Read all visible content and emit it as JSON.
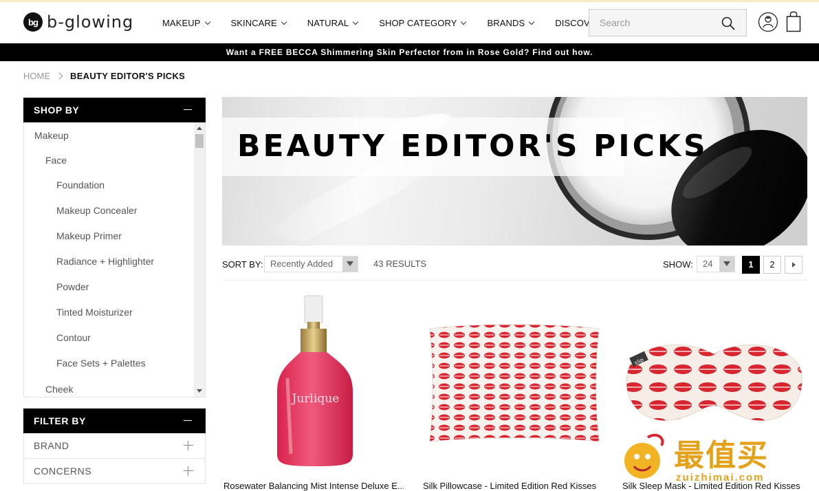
{
  "brand": {
    "logo_mark": "bg",
    "logo_text": "b-glowing"
  },
  "nav": [
    {
      "label": "MAKEUP"
    },
    {
      "label": "SKINCARE"
    },
    {
      "label": "NATURAL"
    },
    {
      "label": "SHOP CATEGORY"
    },
    {
      "label": "BRANDS"
    },
    {
      "label": "DISCOVERY"
    }
  ],
  "search": {
    "placeholder": "Search",
    "icon": "search-icon"
  },
  "header_icons": [
    "account-icon",
    "shopping-bag-icon"
  ],
  "promo": {
    "text": "Want a FREE BECCA Shimmering Skin Perfector from in Rose Gold? Find out how."
  },
  "breadcrumb": {
    "home": "HOME",
    "current": "BEAUTY EDITOR'S PICKS"
  },
  "sidebar": {
    "shop_by_title": "SHOP BY",
    "categories": [
      {
        "label": "Makeup"
      },
      {
        "label": "Face"
      },
      {
        "label": "Foundation"
      },
      {
        "label": "Makeup Concealer"
      },
      {
        "label": "Makeup Primer"
      },
      {
        "label": "Radiance + Highlighter"
      },
      {
        "label": "Powder"
      },
      {
        "label": "Tinted Moisturizer"
      },
      {
        "label": "Contour"
      },
      {
        "label": "Face Sets + Palettes"
      },
      {
        "label": "Cheek"
      }
    ],
    "filter_by_title": "FILTER BY",
    "filters": [
      {
        "label": "BRAND"
      },
      {
        "label": "CONCERNS"
      }
    ]
  },
  "banner": {
    "title": "BEAUTY EDITOR'S PICKS"
  },
  "toolbar": {
    "sort_label": "SORT BY:",
    "sort_value": "Recently Added",
    "results": "43 RESULTS",
    "show_label": "SHOW:",
    "show_value": "24",
    "pages": [
      "1",
      "2"
    ],
    "current_page": "1"
  },
  "products": [
    {
      "name": "Rosewater Balancing Mist Intense Deluxe E..."
    },
    {
      "name": "Silk Pillowcase - Limited Edition Red Kisses"
    },
    {
      "name": "Silk Sleep Mask - Limited Edition Red Kisses"
    }
  ],
  "colors": {
    "accent": "#000000",
    "promo_bg": "#000000",
    "lip_red": "#d7262f",
    "bottle_pink": "#e8375f"
  },
  "watermark": {
    "text": "最值买",
    "url": "zuizhimai.com"
  }
}
